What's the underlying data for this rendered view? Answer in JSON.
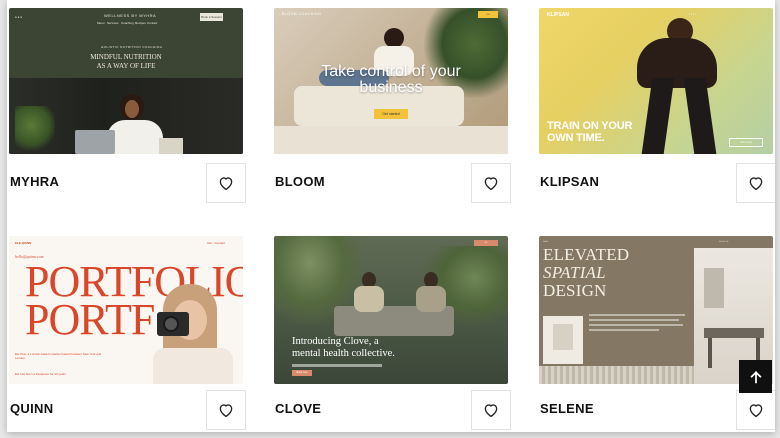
{
  "cards": [
    {
      "name": "MYHRA",
      "preview": {
        "brand": "WELLNESS BY MYHRA",
        "nav": [
          "Menu",
          "Services",
          "Coaching",
          "Recipes",
          "Contact"
        ],
        "cta": "Book a Session",
        "kicker": "HOLISTIC NUTRITION COACHING",
        "headline_1": "MINDFUL NUTRITION",
        "headline_2": "AS A WAY OF LIFE"
      }
    },
    {
      "name": "BLOOM",
      "preview": {
        "brand": "BLOOM COACHING",
        "headline": "Take control of your business",
        "cta": "Get started"
      }
    },
    {
      "name": "KLIPSAN",
      "preview": {
        "brand": "KLIPSAN",
        "headline_1": "TRAIN ON YOUR",
        "headline_2": "OWN TIME.",
        "cta": "Join now"
      }
    },
    {
      "name": "QUINN",
      "preview": {
        "brand": "ELE QUINN",
        "link": "hello@quinn.com",
        "headline_1": "PORTFOLIO",
        "headline_2": "PORTF",
        "body": "Ele Plus, a London-based creative based between New York and London.",
        "footer": "Ele has been a freelancer for 12 years"
      }
    },
    {
      "name": "CLOVE",
      "preview": {
        "headline_1": "Introducing Clove, a",
        "headline_2": "mental health collective.",
        "cta": "Book now"
      }
    },
    {
      "name": "SELENE",
      "preview": {
        "headline_1": "ELEVATED",
        "headline_2": "SPATIAL",
        "headline_3": "DESIGN"
      }
    }
  ],
  "icons": {
    "favorite": "heart-icon",
    "scroll_top": "arrow-up-icon"
  },
  "colors": {
    "quinn_accent": "#d8472a",
    "bloom_cta": "#f2c33a",
    "scroll_button": "#101010"
  }
}
